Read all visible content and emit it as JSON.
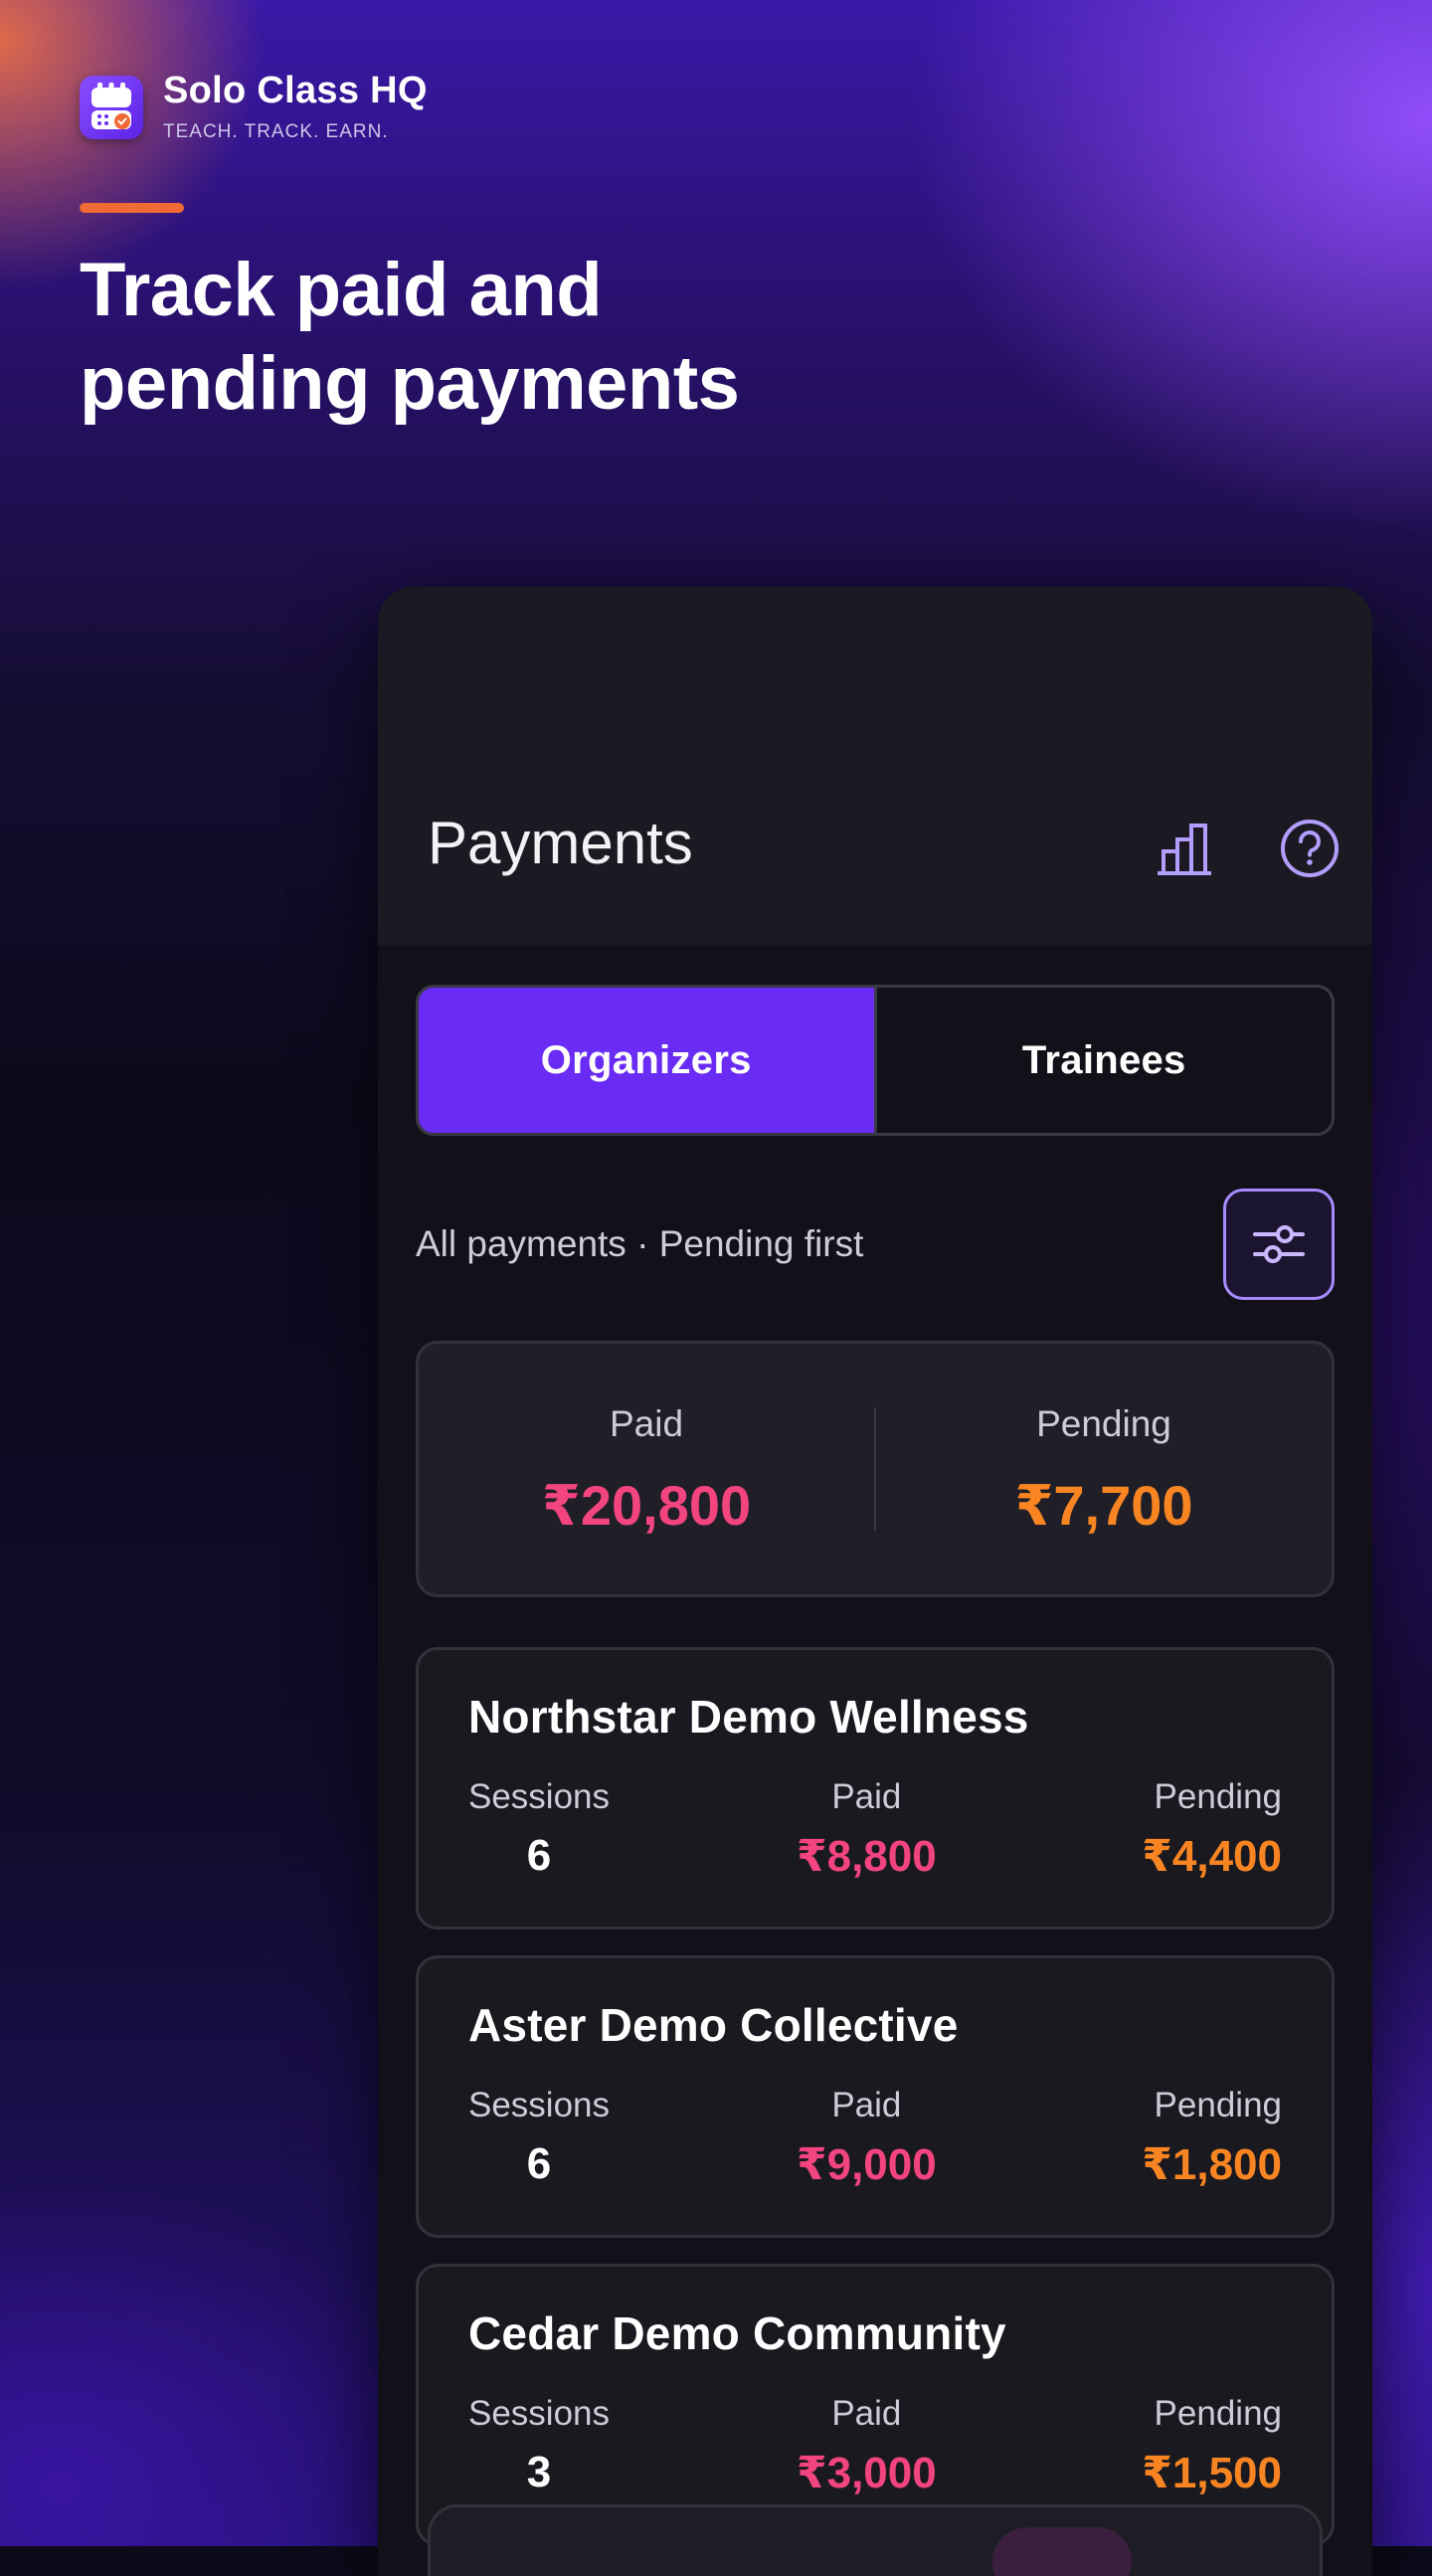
{
  "brand": {
    "name": "Solo Class HQ",
    "tagline": "TEACH. TRACK. EARN.",
    "logo_icon": "calendar-check-icon"
  },
  "headline": {
    "line1": "Track paid and",
    "line2": "pending payments"
  },
  "colors": {
    "accent": "#6a2cf5",
    "paid": "#f2447f",
    "pending": "#f98522",
    "accent_bar": "#f06a35"
  },
  "app": {
    "title": "Payments",
    "header_icons": [
      "bar-chart-icon",
      "help-circle-icon"
    ],
    "tabs": [
      {
        "label": "Organizers",
        "active": true
      },
      {
        "label": "Trainees",
        "active": false
      }
    ],
    "filter_caption": "All payments · Pending first",
    "filter_icon": "sliders-icon",
    "summary": {
      "paid_label": "Paid",
      "paid_value": "₹20,800",
      "pending_label": "Pending",
      "pending_value": "₹7,700"
    },
    "stat_labels": {
      "sessions": "Sessions",
      "paid": "Paid",
      "pending": "Pending"
    },
    "organizers": [
      {
        "name": "Northstar Demo Wellness",
        "sessions": "6",
        "paid": "₹8,800",
        "pending": "₹4,400"
      },
      {
        "name": "Aster Demo Collective",
        "sessions": "6",
        "paid": "₹9,000",
        "pending": "₹1,800"
      },
      {
        "name": "Cedar Demo Community",
        "sessions": "3",
        "paid": "₹3,000",
        "pending": "₹1,500"
      }
    ]
  }
}
